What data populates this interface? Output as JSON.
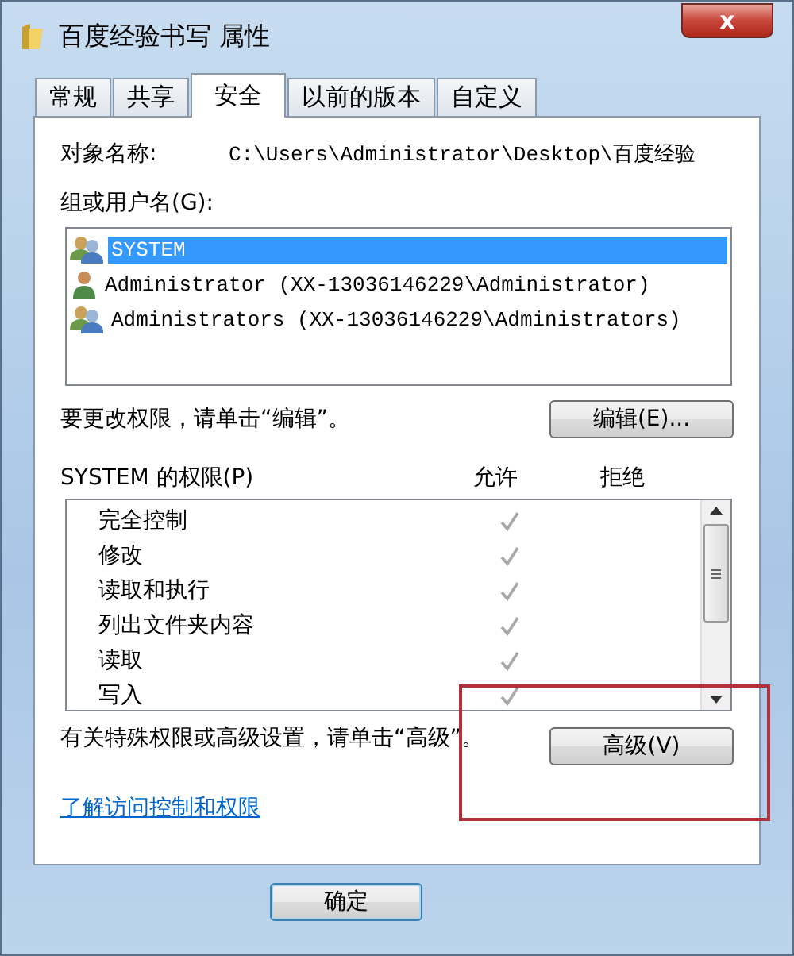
{
  "window": {
    "title": "百度经验书写 属性",
    "close": "x"
  },
  "tabs": [
    {
      "label": "常规",
      "selected": false
    },
    {
      "label": "共享",
      "selected": false
    },
    {
      "label": "安全",
      "selected": true
    },
    {
      "label": "以前的版本",
      "selected": false
    },
    {
      "label": "自定义",
      "selected": false
    }
  ],
  "object_name": {
    "label": "对象名称:",
    "value": "C:\\Users\\Administrator\\Desktop\\百度经验"
  },
  "groups": {
    "label": "组或用户名(G):",
    "items": [
      {
        "name": "SYSTEM",
        "kind": "group",
        "selected": true
      },
      {
        "name": "Administrator (XX-13036146229\\Administrator)",
        "kind": "user",
        "selected": false
      },
      {
        "name": "Administrators (XX-13036146229\\Administrators)",
        "kind": "group",
        "selected": false
      }
    ]
  },
  "edit_hint": "要更改权限，请单击“编辑”。",
  "edit_button": "编辑(E)...",
  "permissions": {
    "label": "SYSTEM 的权限(P)",
    "allow_header": "允许",
    "deny_header": "拒绝",
    "rows": [
      {
        "name": "完全控制",
        "allow": true,
        "deny": false
      },
      {
        "name": "修改",
        "allow": true,
        "deny": false
      },
      {
        "name": "读取和执行",
        "allow": true,
        "deny": false
      },
      {
        "name": "列出文件夹内容",
        "allow": true,
        "deny": false
      },
      {
        "name": "读取",
        "allow": true,
        "deny": false
      },
      {
        "name": "写入",
        "allow": true,
        "deny": false
      }
    ]
  },
  "advanced_hint": "有关特殊权限或高级设置，请单击“高级”。",
  "advanced_button": "高级(V)",
  "help_link": "了解访问控制和权限",
  "buttons": [
    "确定"
  ],
  "annotation": {
    "kind": "rectangle"
  }
}
